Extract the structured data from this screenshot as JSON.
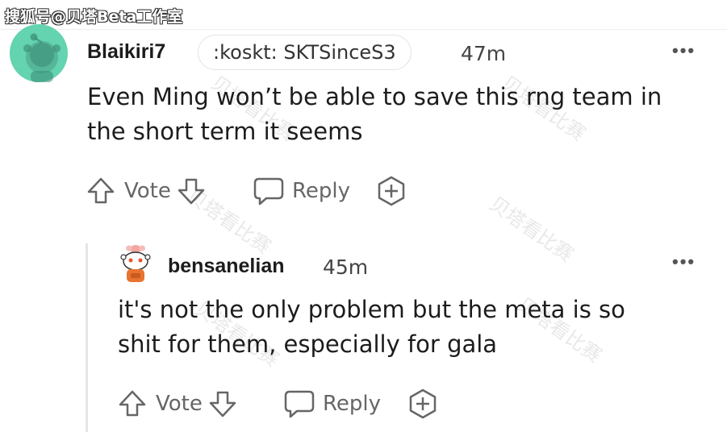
{
  "source_tag": "搜狐号@贝塔Beta工作室",
  "watermark_text": "贝塔看比赛",
  "comments": [
    {
      "username": "Blaikiri7",
      "flair": ":koskt: SKTSinceS3",
      "time": "47m",
      "body_line1": "Even Ming won’t be able to save this rng team in",
      "body_line2": "the short term it seems",
      "vote_label": "Vote",
      "reply_label": "Reply",
      "more_label": "•••"
    },
    {
      "username": "bensanelian",
      "time": "45m",
      "body_line1": "it's not the only problem but the meta is so",
      "body_line2": "shit for them, especially for gala",
      "vote_label": "Vote",
      "reply_label": "Reply",
      "more_label": "•••"
    }
  ],
  "colors": {
    "avatar_bg": "#63d3b0",
    "icon_gray": "#666666",
    "thread_line": "#e5e5e5"
  },
  "icons": [
    "snoo-avatar",
    "upvote-arrow-icon",
    "downvote-arrow-icon",
    "reply-bubble-icon",
    "award-plus-icon",
    "more-options-icon"
  ]
}
